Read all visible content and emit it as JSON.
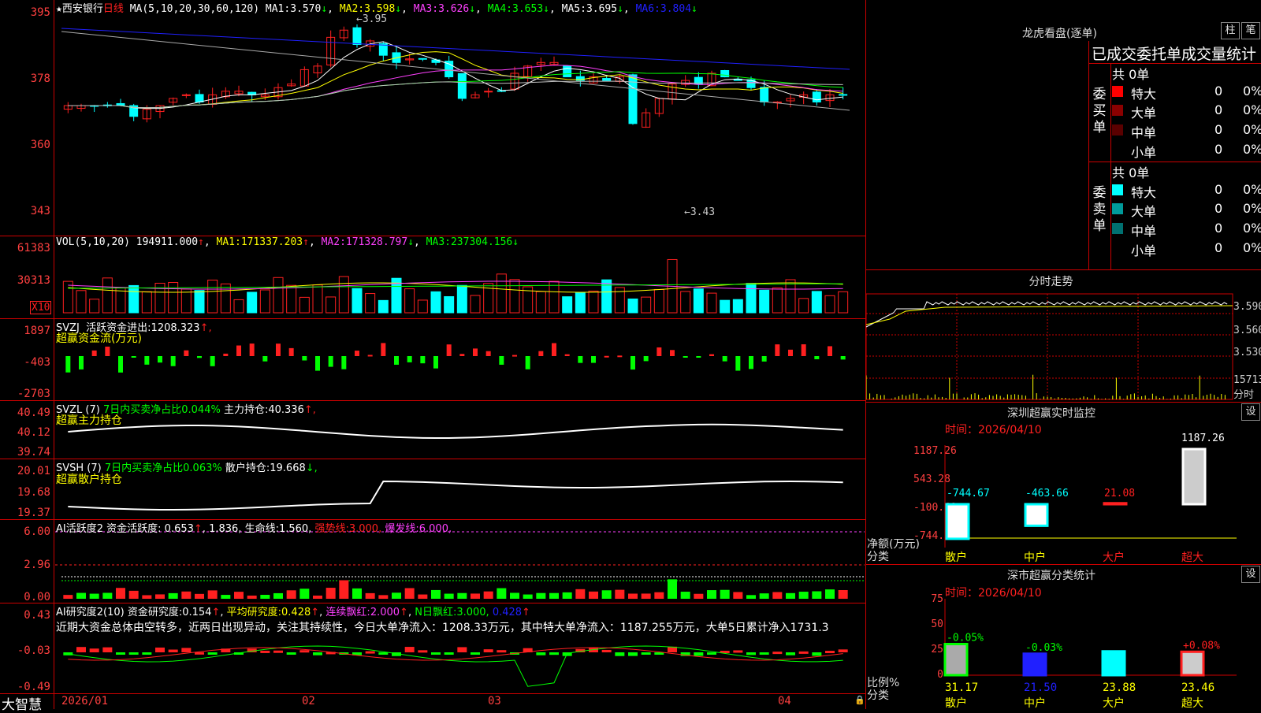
{
  "colors": {
    "up": "#ff2020",
    "down": "#00ffff",
    "grid": "#c00000",
    "ma1": "#ffffff",
    "ma2": "#ffff00",
    "ma3": "#ff40ff",
    "ma4": "#00ff00",
    "ma5": "#c0c0c0",
    "ma6": "#2020ff"
  },
  "main": {
    "star": "★",
    "stock": "西安银行",
    "period": "日线",
    "ma_label": "MA(5,10,20,30,60,120)",
    "ma": [
      {
        "k": "MA1:",
        "v": "3.570",
        "a": "↓"
      },
      {
        "k": "MA2:",
        "v": "3.598",
        "a": "↓"
      },
      {
        "k": "MA3:",
        "v": "3.626",
        "a": "↓"
      },
      {
        "k": "MA4:",
        "v": "3.653",
        "a": "↓"
      },
      {
        "k": "MA5:",
        "v": "3.695",
        "a": "↓"
      },
      {
        "k": "MA6:",
        "v": "3.804",
        "a": "↓"
      }
    ],
    "axis": [
      "395",
      "378",
      "360",
      "343"
    ],
    "high_mark": "3.95",
    "low_mark": "3.43"
  },
  "vol": {
    "label": "VOL(5,10,20)",
    "value": "194911.000",
    "v_arrow": "↑",
    "ma": [
      {
        "k": "MA1:",
        "v": "171337.203",
        "a": "↑"
      },
      {
        "k": "MA2:",
        "v": "171328.797",
        "a": "↓"
      },
      {
        "k": "MA3:",
        "v": "237304.156",
        "a": "↓"
      }
    ],
    "axis": [
      "61383",
      "30313"
    ],
    "unit": "X10"
  },
  "svzj": {
    "label": "SVZJ",
    "name": "活跃资金进出:",
    "value": "1208.323",
    "arrow": "↑,",
    "sub": "超赢资金流(万元)",
    "axis": [
      "1897",
      "-403",
      "-2703"
    ]
  },
  "svzl": {
    "label": "SVZL (7)",
    "ratio": "7日内买卖净占比0.044%",
    "name": "主力持仓:",
    "value": "40.336",
    "arrow": "↑,",
    "sub": "超赢主力持仓",
    "axis": [
      "40.49",
      "40.12",
      "39.74"
    ]
  },
  "svsh": {
    "label": "SVSH (7)",
    "ratio": "7日内买卖净占比0.063%",
    "name": "散户持仓:",
    "value": "19.668",
    "arrow": "↓,",
    "sub": "超赢散户持仓",
    "axis": [
      "20.01",
      "19.68",
      "19.37"
    ]
  },
  "ai1": {
    "label": "AI活跃度2",
    "name": "资金活跃度:",
    "value": "0.653",
    "v2": "1.836",
    "life": "生命线:",
    "life_v": "1.560,",
    "strong": "强势线:",
    "strong_v": "3.000,",
    "burst": "爆发线:",
    "burst_v": "6.000,",
    "axis": [
      "6.00",
      "2.96",
      "0.00"
    ]
  },
  "ai2": {
    "label": "AI研究度2(10)",
    "name": "资金研究度:",
    "value": "0.154",
    "avg": "平均研究度:",
    "avg_v": "0.428",
    "cont": "连续飘红:",
    "cont_v": "2.000",
    "n": "N日飘红:",
    "n_v": "3.000,",
    "last": "0.428",
    "axis": [
      "0.43",
      "-0.03",
      "-0.49"
    ],
    "text": "近期大资金总体由空转多，近两日出现异动，关注其持续性，今日大单净流入：1208.33万元，其中特大单净流入：1187.255万元，大单5日累计净入1731.3"
  },
  "dates": [
    "2026/01",
    "02",
    "03",
    "04"
  ],
  "brand": "大智慧",
  "right": {
    "lhkp": "龙虎看盘(逐单)",
    "btn1": "柱",
    "btn2": "笔",
    "order_title": "已成交委托单成交量统计",
    "buy_label": "委买单",
    "sell_label": "委卖单",
    "buy_total": "共 0单",
    "sell_total": "共 0单",
    "buy_rows": [
      {
        "name": "特大",
        "n": "0",
        "p": "0%"
      },
      {
        "name": "大单",
        "n": "0",
        "p": "0%"
      },
      {
        "name": "中单",
        "n": "0",
        "p": "0%"
      },
      {
        "name": "小单",
        "n": "0",
        "p": "0%"
      }
    ],
    "sell_rows": [
      {
        "name": "特大",
        "n": "0",
        "p": "0%"
      },
      {
        "name": "大单",
        "n": "0",
        "p": "0%"
      },
      {
        "name": "中单",
        "n": "0",
        "p": "0%"
      },
      {
        "name": "小单",
        "n": "0",
        "p": "0%"
      }
    ],
    "fenshi_title": "分时走势",
    "fenshi_axis": [
      "3.590",
      "3.560",
      "3.530"
    ],
    "fenshi_vol": "15713",
    "fenshi_unit": "分时",
    "sz_title": "深圳超赢实时监控",
    "set": "设",
    "time_label": "时间：",
    "time": "2026/04/10",
    "sz_axis": [
      "1187.26",
      "543.28",
      "-100.69",
      "-744.67"
    ],
    "sz_ylabel": "净额(万元)",
    "sz_xlabel": "分类",
    "sz_values": [
      "-744.67",
      "-463.66",
      "21.08",
      "1187.26"
    ],
    "cats": [
      "散户",
      "中户",
      "大户",
      "超大"
    ],
    "cls_title": "深市超赢分类统计",
    "cls_axis": [
      "75",
      "50",
      "25",
      "0"
    ],
    "cls_ylabel": "比例%",
    "cls_xlabel": "分类",
    "cls_pct": [
      "-0.05%",
      "-0.03%",
      "",
      "+0.08%"
    ],
    "cls_values": [
      "31.17",
      "21.50",
      "23.88",
      "23.46"
    ]
  }
}
